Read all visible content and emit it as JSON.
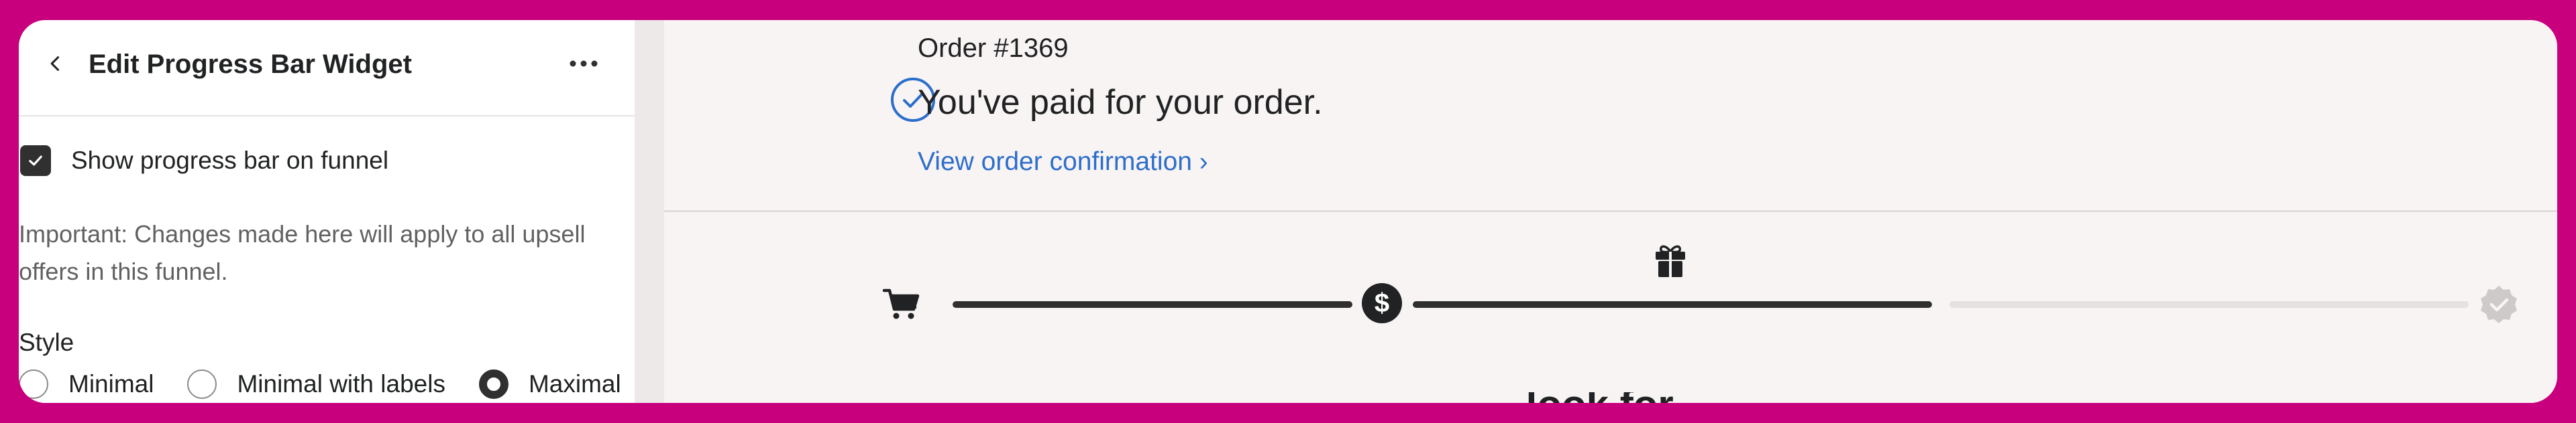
{
  "panel": {
    "title": "Edit Progress Bar Widget",
    "show_progress_label": "Show progress bar on funnel",
    "show_progress_checked": true,
    "notice": "Important: Changes made here will apply to all upsell offers in this funnel.",
    "style_label": "Style",
    "style_options": [
      "Minimal",
      "Minimal with labels",
      "Maximal"
    ],
    "style_selected": "Maximal"
  },
  "preview": {
    "order_number": "Order #1369",
    "paid_message": "You've paid for your order.",
    "view_link": "View order confirmation ›",
    "next_heading_partial": "... look for..."
  },
  "progress": {
    "steps": [
      "cart-icon",
      "dollar-icon",
      "gift-icon",
      "badge-check-icon"
    ],
    "completed_segments": 2,
    "total_segments": 3
  },
  "colors": {
    "frame": "#C8007D",
    "link": "#2C6ECB",
    "dark": "#303030",
    "paid_icon": "#2C6ECB"
  }
}
